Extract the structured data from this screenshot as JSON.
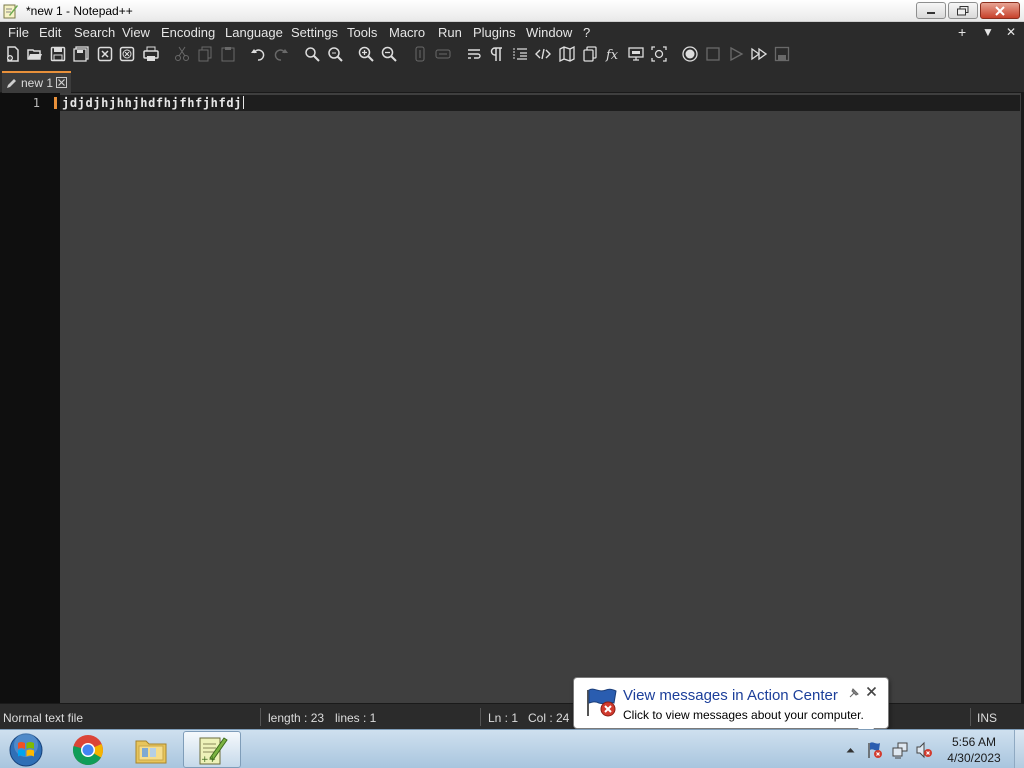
{
  "window": {
    "title": "*new 1 - Notepad++"
  },
  "menubar": {
    "items": [
      "File",
      "Edit",
      "Search",
      "View",
      "Encoding",
      "Language",
      "Settings",
      "Tools",
      "Macro",
      "Run",
      "Plugins",
      "Window",
      "?"
    ],
    "right": [
      "+",
      "▼",
      "✕"
    ]
  },
  "toolbar": {
    "icons": [
      "new-file-icon",
      "open-file-icon",
      "save-icon",
      "save-all-icon",
      "close-icon",
      "close-all-icon",
      "print-icon",
      "cut-icon",
      "copy-icon",
      "paste-icon",
      "undo-icon",
      "redo-icon",
      "find-icon",
      "replace-icon",
      "zoom-in-icon",
      "zoom-out-icon",
      "sync-vertical-icon",
      "sync-horizontal-icon",
      "word-wrap-icon",
      "show-all-chars-icon",
      "indent-guide-icon",
      "xml-tag-icon",
      "document-map-icon",
      "document-list-icon",
      "function-list-icon",
      "monitoring-icon",
      "folder-workspace-icon",
      "record-macro-icon",
      "stop-macro-icon",
      "play-macro-icon",
      "run-macro-multiple-icon",
      "save-macro-icon"
    ]
  },
  "tabs": [
    {
      "label": "new 1",
      "modified": true
    }
  ],
  "editor": {
    "lines": [
      {
        "number": "1",
        "text": "jdjdjhjhhjhdfhjfhfjhfdj"
      }
    ]
  },
  "statusbar": {
    "file_type": "Normal text file",
    "length": "length : 23",
    "lines": "lines : 1",
    "ln": "Ln : 1",
    "col": "Col : 24",
    "mode": "INS"
  },
  "notification": {
    "title": "View messages in Action Center",
    "text": "Click to view messages about your computer."
  },
  "taskbar": {
    "items": [
      "start-button",
      "chrome",
      "file-explorer",
      "notepad-plus-plus"
    ],
    "clock_time": "5:56 AM",
    "clock_date": "4/30/2023"
  },
  "colors": {
    "editor_bg": "#3f3f3f",
    "gutter_bg": "#0f0f0f",
    "chrome_bg": "#2b2b2b",
    "accent_orange": "#e8903a",
    "balloon_title": "#1c3f9a"
  }
}
